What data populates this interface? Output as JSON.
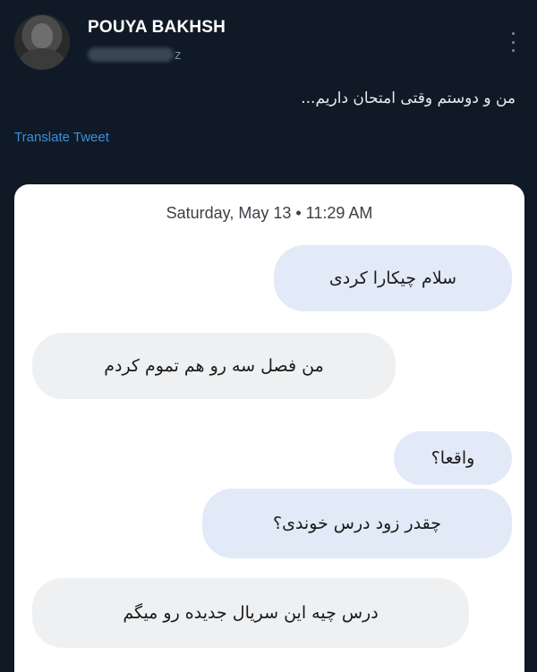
{
  "tweet": {
    "author_name": "POUYA BAKHSH",
    "handle_visible_tail": "z",
    "text": "من و دوستم وقتی امتحان داریم...",
    "translate_label": "Translate Tweet"
  },
  "chat": {
    "date": "Saturday, May 13 • 11:29 AM",
    "messages": [
      {
        "side": "sent",
        "text": "سلام چیکارا کردی"
      },
      {
        "side": "received",
        "text": "من فصل سه رو هم تموم کردم"
      },
      {
        "side": "sent",
        "text": "واقعا؟"
      },
      {
        "side": "sent",
        "text": "چقدر زود درس خوندی؟"
      },
      {
        "side": "received",
        "text": "درس چیه این سریال جدیده رو میگم"
      }
    ]
  },
  "colors": {
    "background": "#101a26",
    "link": "#3a8fe0",
    "sent_bubble": "#e2eaf8",
    "received_bubble": "#eef0f2"
  },
  "icons": {
    "more": "vertical-ellipsis"
  }
}
